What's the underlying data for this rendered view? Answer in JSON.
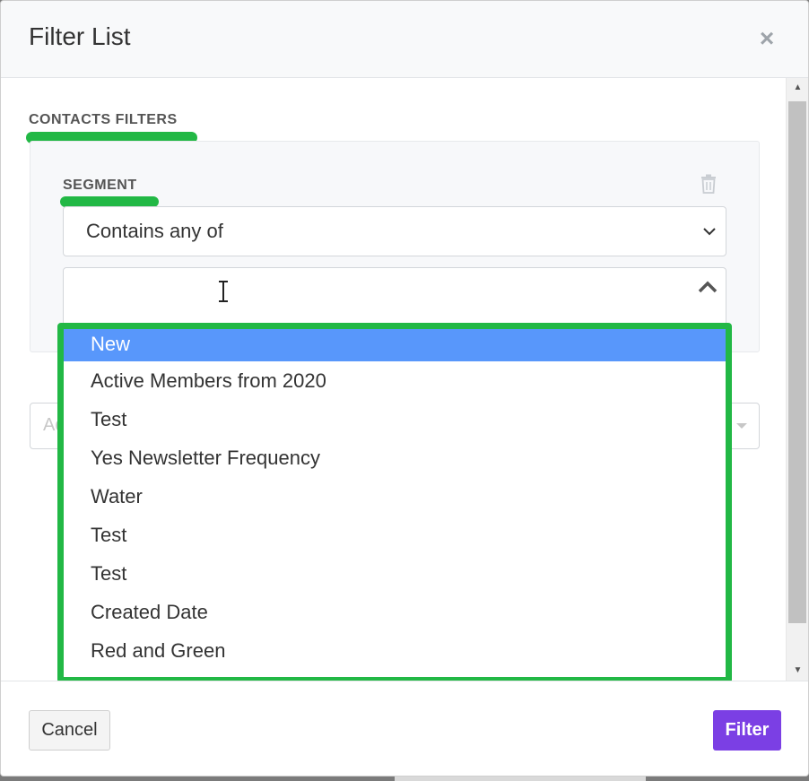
{
  "modal": {
    "title": "Filter List",
    "close_glyph": "×"
  },
  "contacts_filters": {
    "label": "CONTACTS FILTERS"
  },
  "segment": {
    "label": "SEGMENT",
    "operator_value": "Contains any of",
    "second_field_placeholder": "Ad"
  },
  "dropdown": {
    "items": [
      "New",
      "Active Members from 2020",
      "Test",
      "Yes Newsletter Frequency",
      "Water",
      "Test",
      "Test",
      "Created Date",
      "Red and Green"
    ],
    "highlighted_index": 0
  },
  "footer": {
    "cancel_label": "Cancel",
    "filter_label": "Filter"
  },
  "colors": {
    "accent_highlight": "#22b845",
    "selected_option": "#5897fb",
    "primary_button": "#7b3fe4"
  },
  "icons": {
    "close": "close-icon",
    "trash": "trash-icon",
    "select_chevron": "chevron-down-icon",
    "multi_caret": "chevron-up-icon",
    "text_cursor": "text-cursor-icon"
  }
}
